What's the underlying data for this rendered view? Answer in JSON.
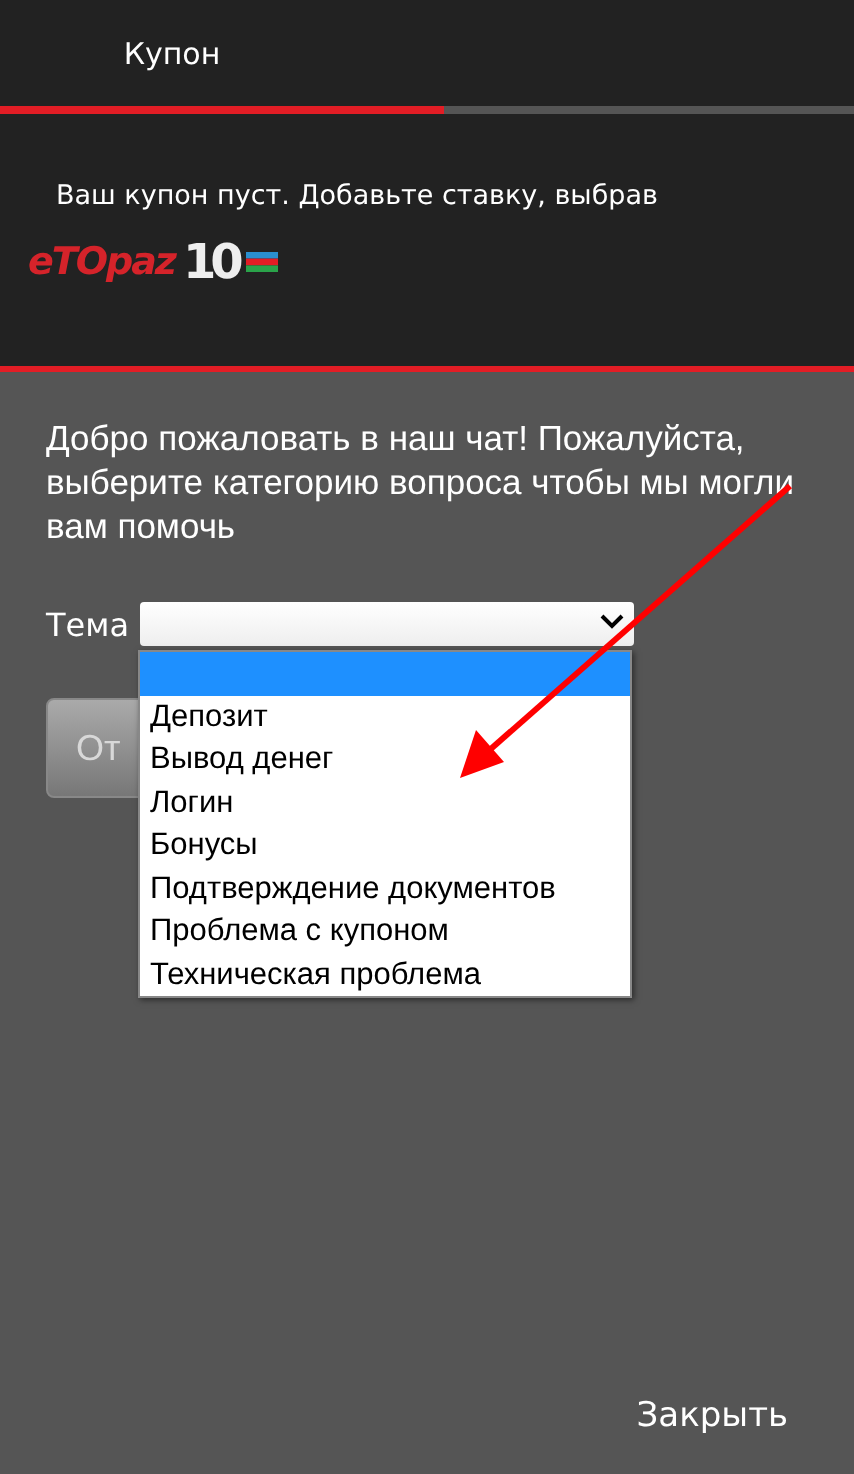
{
  "coupon_panel": {
    "tabs": [
      {
        "label": "Купон",
        "selected": true
      }
    ],
    "message": "Ваш купон пуст. Добавьте ставку, выбрав",
    "logo": {
      "brand": "eTOpaz",
      "badge": "10"
    }
  },
  "chat": {
    "welcome": "Добро пожаловать в наш чат! Пожалуйста, выберите категорию вопроса чтобы мы могли вам помочь",
    "topic_label": "Тема",
    "topic_select": {
      "expanded": true,
      "options": [
        {
          "selected": true
        },
        {
          "label": "Депозит",
          "selected": false
        },
        {
          "label": "Вывод денег",
          "selected": false
        },
        {
          "label": "Логин",
          "selected": false
        },
        {
          "label": "Бонусы",
          "selected": false
        },
        {
          "label": "Подтверждение документов",
          "selected": false
        },
        {
          "label": "Проблема с купоном",
          "selected": false
        },
        {
          "label": "Техническая проблема",
          "selected": false
        }
      ]
    },
    "send_button": {
      "label": "От",
      "disabled": true
    },
    "close_link": "Закрыть"
  }
}
